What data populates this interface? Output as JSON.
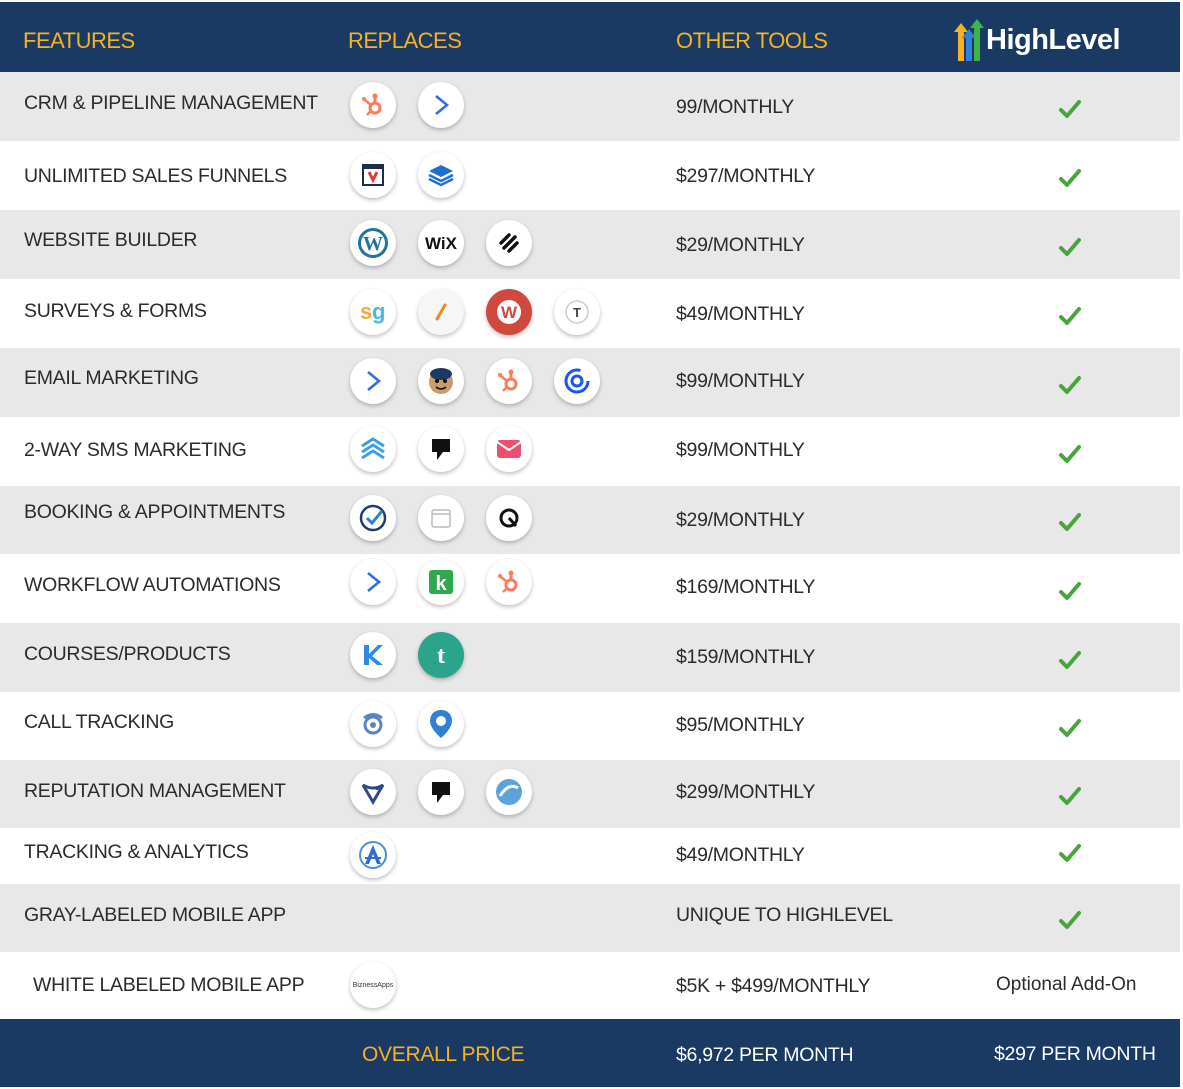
{
  "header": {
    "features": "FEATURES",
    "replaces": "REPLACES",
    "other_tools": "OTHER TOOLS",
    "brand": "HighLevel"
  },
  "colors": {
    "navy": "#1b3a63",
    "gold": "#f5b223",
    "check": "#46a53c",
    "row_alt": "#e8e8e8"
  },
  "rows": [
    {
      "feature": "CRM & PIPELINE MANAGEMENT",
      "price": "99/MONTHLY",
      "highlevel": "check",
      "logos": [
        "hubspot-icon",
        "activecampaign-icon"
      ]
    },
    {
      "feature": "UNLIMITED SALES FUNNELS",
      "price": "$297/MONTHLY",
      "highlevel": "check",
      "logos": [
        "clickfunnels-icon",
        "leadpages-icon"
      ]
    },
    {
      "feature": "WEBSITE BUILDER",
      "price": "$29/MONTHLY",
      "highlevel": "check",
      "logos": [
        "wordpress-icon",
        "wix-icon",
        "squarespace-icon"
      ]
    },
    {
      "feature": "SURVEYS & FORMS",
      "price": "$49/MONTHLY",
      "highlevel": "check",
      "logos": [
        "surveygizmo-icon",
        "jotform-icon",
        "wufoo-icon",
        "typeform-icon"
      ]
    },
    {
      "feature": "EMAIL MARKETING",
      "price": "$99/MONTHLY",
      "highlevel": "check",
      "logos": [
        "activecampaign-icon",
        "mailchimp-icon",
        "hubspot-icon",
        "constantcontact-icon"
      ]
    },
    {
      "feature": "2-WAY SMS MARKETING",
      "price": "$99/MONTHLY",
      "highlevel": "check",
      "logos": [
        "layers-icon",
        "podium-icon",
        "mail-icon"
      ]
    },
    {
      "feature": "BOOKING & APPOINTMENTS",
      "price": "$29/MONTHLY",
      "highlevel": "check",
      "logos": [
        "calendly-check-icon",
        "calendar-icon",
        "acuity-icon"
      ]
    },
    {
      "feature": "WORKFLOW AUTOMATIONS",
      "price": "$169/MONTHLY",
      "highlevel": "check",
      "logos": [
        "activecampaign-icon",
        "keap-icon",
        "hubspot-icon"
      ]
    },
    {
      "feature": "COURSES/PRODUCTS",
      "price": "$159/MONTHLY",
      "highlevel": "check",
      "logos": [
        "kajabi-icon",
        "teachable-icon"
      ]
    },
    {
      "feature": "CALL TRACKING",
      "price": "$95/MONTHLY",
      "highlevel": "check",
      "logos": [
        "callrail-icon",
        "location-phone-icon"
      ]
    },
    {
      "feature": "REPUTATION MANAGEMENT",
      "price": "$299/MONTHLY",
      "highlevel": "check",
      "logos": [
        "birdeye-icon",
        "podium-icon",
        "swirl-icon"
      ]
    },
    {
      "feature": "TRACKING & ANALYTICS",
      "price": "$49/MONTHLY",
      "highlevel": "check",
      "logos": [
        "analytics-icon"
      ]
    },
    {
      "feature": "GRAY-LABELED MOBILE APP",
      "price": "UNIQUE TO HIGHLEVEL",
      "highlevel": "check",
      "logos": []
    },
    {
      "feature": "WHITE LABELED MOBILE APP",
      "price": "$5K + $499/MONTHLY",
      "highlevel": "Optional Add-On",
      "logos": [
        "bizness-apps-icon"
      ],
      "logo_text": "BiznessApps"
    }
  ],
  "footer": {
    "label": "OVERALL PRICE",
    "other_price": "$6,972 PER MONTH",
    "highlevel_price": "$297 PER MONTH"
  }
}
